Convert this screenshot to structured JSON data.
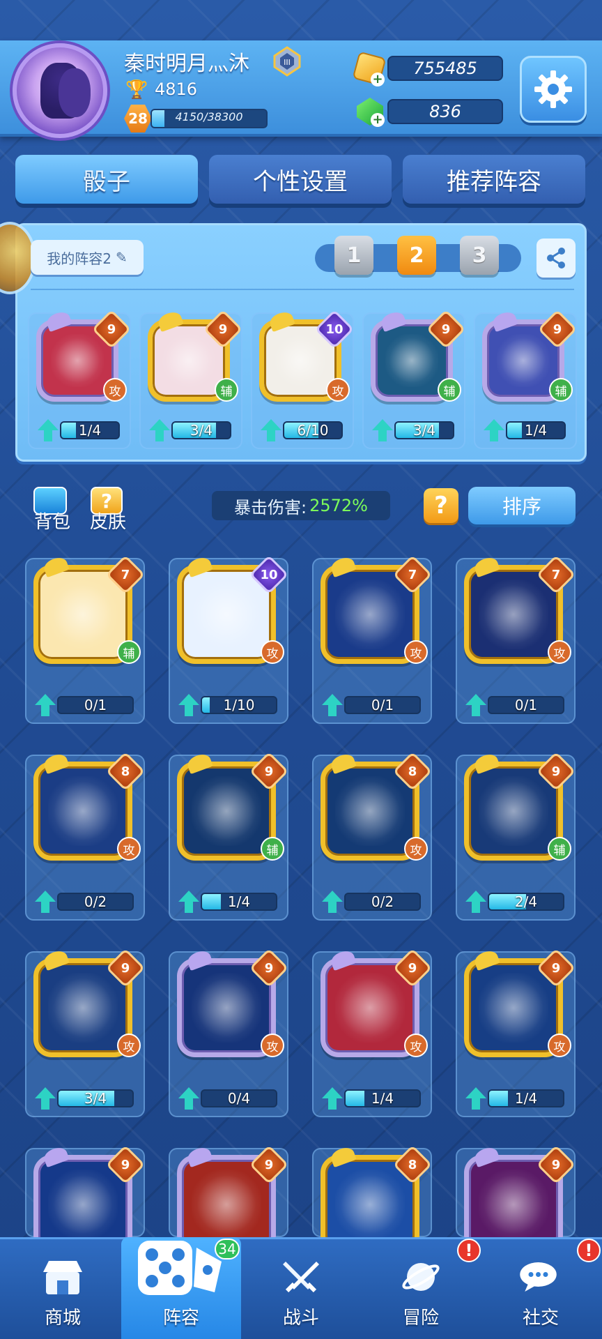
{
  "header": {
    "username": "秦时明月灬沐",
    "trophies": "4816",
    "level": "28",
    "xp_text": "4150/38300",
    "xp_fraction": 0.109,
    "gold": "755485",
    "gems": "836"
  },
  "tabs": [
    {
      "label": "骰子",
      "active": true
    },
    {
      "label": "个性设置",
      "active": false
    },
    {
      "label": "推荐阵容",
      "active": false
    }
  ],
  "loadout": {
    "name": "我的阵容2",
    "slots": [
      "1",
      "2",
      "3"
    ],
    "active_slot": "2",
    "dice": [
      {
        "name": "crab",
        "level": "9",
        "role": "攻",
        "progress": "1/4",
        "fraction": 0.25,
        "frame": "purple",
        "badge": "orange",
        "art": "#c2334c"
      },
      {
        "name": "sakura",
        "level": "9",
        "role": "辅",
        "progress": "3/4",
        "fraction": 0.75,
        "frame": "gold",
        "badge": "orange",
        "art": "#f3dde4"
      },
      {
        "name": "shuriken",
        "level": "10",
        "role": "攻",
        "progress": "6/10",
        "fraction": 0.6,
        "frame": "gold",
        "badge": "purple",
        "art": "#f2efe9"
      },
      {
        "name": "dandelion",
        "level": "9",
        "role": "辅",
        "progress": "3/4",
        "fraction": 0.75,
        "frame": "purple",
        "badge": "orange",
        "art": "#1d5a84"
      },
      {
        "name": "twins",
        "level": "9",
        "role": "辅",
        "progress": "1/4",
        "fraction": 0.25,
        "frame": "purple",
        "badge": "orange",
        "art": "#4050b3"
      }
    ]
  },
  "toolbar": {
    "bag_label": "背包",
    "skin_label": "皮肤",
    "crit_label": "暴击伤害:",
    "crit_value": "2572%",
    "help_label": "?",
    "sort_label": "排序"
  },
  "collection": [
    {
      "name": "coin",
      "level": "7",
      "role": "辅",
      "progress": "0/1",
      "fraction": 0.0,
      "frame": "gold",
      "badge": "orange",
      "art": "#fbe7b0"
    },
    {
      "name": "shark",
      "level": "10",
      "role": "攻",
      "progress": "1/10",
      "fraction": 0.1,
      "frame": "gold",
      "badge": "purple",
      "art": "#e8f2ff"
    },
    {
      "name": "gemini",
      "level": "7",
      "role": "攻",
      "progress": "0/1",
      "fraction": 0.0,
      "frame": "gold",
      "badge": "orange",
      "art": "#1a3b8a"
    },
    {
      "name": "taurus",
      "level": "7",
      "role": "攻",
      "progress": "0/1",
      "fraction": 0.0,
      "frame": "gold",
      "badge": "orange",
      "art": "#1b2f73"
    },
    {
      "name": "rabbit",
      "level": "8",
      "role": "攻",
      "progress": "0/2",
      "fraction": 0.0,
      "frame": "gold",
      "badge": "orange",
      "art": "#1b3d85"
    },
    {
      "name": "aries",
      "level": "9",
      "role": "辅",
      "progress": "1/4",
      "fraction": 0.25,
      "frame": "gold",
      "badge": "orange",
      "art": "#14386e"
    },
    {
      "name": "capricorn",
      "level": "8",
      "role": "攻",
      "progress": "0/2",
      "fraction": 0.0,
      "frame": "gold",
      "badge": "orange",
      "art": "#143a74"
    },
    {
      "name": "libra",
      "level": "9",
      "role": "辅",
      "progress": "2/4",
      "fraction": 0.5,
      "frame": "gold",
      "badge": "orange",
      "art": "#183a78"
    },
    {
      "name": "virgo",
      "level": "9",
      "role": "攻",
      "progress": "3/4",
      "fraction": 0.75,
      "frame": "gold",
      "badge": "orange",
      "art": "#1a3e82"
    },
    {
      "name": "leo",
      "level": "9",
      "role": "攻",
      "progress": "0/4",
      "fraction": 0.0,
      "frame": "purple",
      "badge": "orange",
      "art": "#16347a"
    },
    {
      "name": "cancer",
      "level": "9",
      "role": "攻",
      "progress": "1/4",
      "fraction": 0.25,
      "frame": "purple",
      "badge": "orange",
      "art": "#b2283c"
    },
    {
      "name": "scorpio-swirl",
      "level": "9",
      "role": "攻",
      "progress": "1/4",
      "fraction": 0.25,
      "frame": "gold",
      "badge": "orange",
      "art": "#173e85"
    },
    {
      "name": "aquarius",
      "level": "9",
      "role": "",
      "progress": "",
      "fraction": 0.0,
      "frame": "purple",
      "badge": "orange",
      "art": "#15398a"
    },
    {
      "name": "tiger",
      "level": "9",
      "role": "",
      "progress": "",
      "fraction": 0.0,
      "frame": "purple",
      "badge": "orange",
      "art": "#a3281f"
    },
    {
      "name": "coin-s",
      "level": "8",
      "role": "",
      "progress": "",
      "fraction": 0.0,
      "frame": "gold",
      "badge": "orange",
      "art": "#1c4ea6"
    },
    {
      "name": "shadow",
      "level": "9",
      "role": "",
      "progress": "",
      "fraction": 0.0,
      "frame": "purple",
      "badge": "orange",
      "art": "#5a1a66"
    }
  ],
  "nav": [
    {
      "label": "商城",
      "icon": "shop-icon"
    },
    {
      "label": "阵容",
      "icon": "dice-icon",
      "active": true,
      "count": "34"
    },
    {
      "label": "战斗",
      "icon": "swords-icon"
    },
    {
      "label": "冒险",
      "icon": "planet-icon",
      "alert": "!"
    },
    {
      "label": "社交",
      "icon": "chat-icon",
      "alert": "!"
    }
  ]
}
